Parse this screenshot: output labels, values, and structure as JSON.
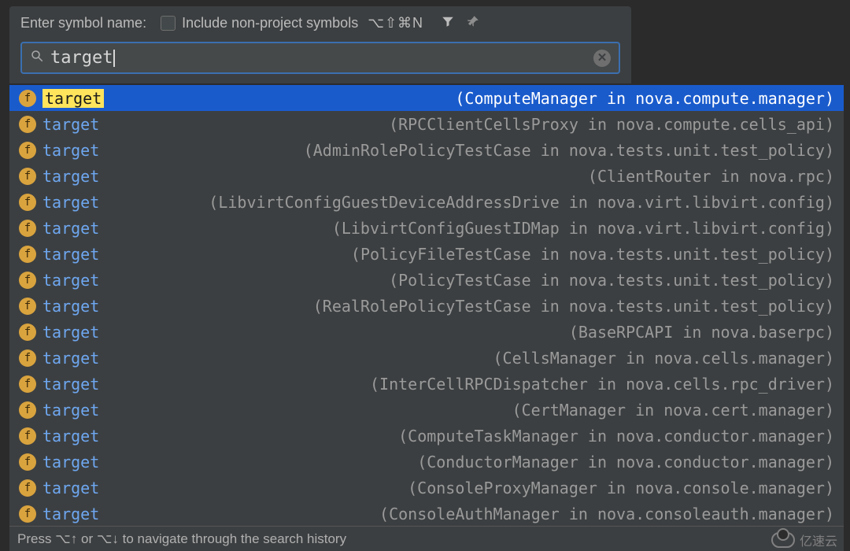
{
  "header": {
    "prompt": "Enter symbol name:",
    "checkbox_label": "Include non-project symbols",
    "shortcut": "⌥⇧⌘N"
  },
  "search": {
    "value": "target"
  },
  "results": [
    {
      "name": "target",
      "location": "(ComputeManager in nova.compute.manager)",
      "selected": true
    },
    {
      "name": "target",
      "location": "(RPCClientCellsProxy in nova.compute.cells_api)",
      "selected": false
    },
    {
      "name": "target",
      "location": "(AdminRolePolicyTestCase in nova.tests.unit.test_policy)",
      "selected": false
    },
    {
      "name": "target",
      "location": "(ClientRouter in nova.rpc)",
      "selected": false
    },
    {
      "name": "target",
      "location": "(LibvirtConfigGuestDeviceAddressDrive in nova.virt.libvirt.config)",
      "selected": false
    },
    {
      "name": "target",
      "location": "(LibvirtConfigGuestIDMap in nova.virt.libvirt.config)",
      "selected": false
    },
    {
      "name": "target",
      "location": "(PolicyFileTestCase in nova.tests.unit.test_policy)",
      "selected": false
    },
    {
      "name": "target",
      "location": "(PolicyTestCase in nova.tests.unit.test_policy)",
      "selected": false
    },
    {
      "name": "target",
      "location": "(RealRolePolicyTestCase in nova.tests.unit.test_policy)",
      "selected": false
    },
    {
      "name": "target",
      "location": "(BaseRPCAPI in nova.baserpc)",
      "selected": false
    },
    {
      "name": "target",
      "location": "(CellsManager in nova.cells.manager)",
      "selected": false
    },
    {
      "name": "target",
      "location": "(InterCellRPCDispatcher in nova.cells.rpc_driver)",
      "selected": false
    },
    {
      "name": "target",
      "location": "(CertManager in nova.cert.manager)",
      "selected": false
    },
    {
      "name": "target",
      "location": "(ComputeTaskManager in nova.conductor.manager)",
      "selected": false
    },
    {
      "name": "target",
      "location": "(ConductorManager in nova.conductor.manager)",
      "selected": false
    },
    {
      "name": "target",
      "location": "(ConsoleProxyManager in nova.console.manager)",
      "selected": false
    },
    {
      "name": "target",
      "location": "(ConsoleAuthManager in nova.consoleauth.manager)",
      "selected": false
    }
  ],
  "hint": "Press ⌥↑ or ⌥↓ to navigate through the search history",
  "watermark": "亿速云"
}
